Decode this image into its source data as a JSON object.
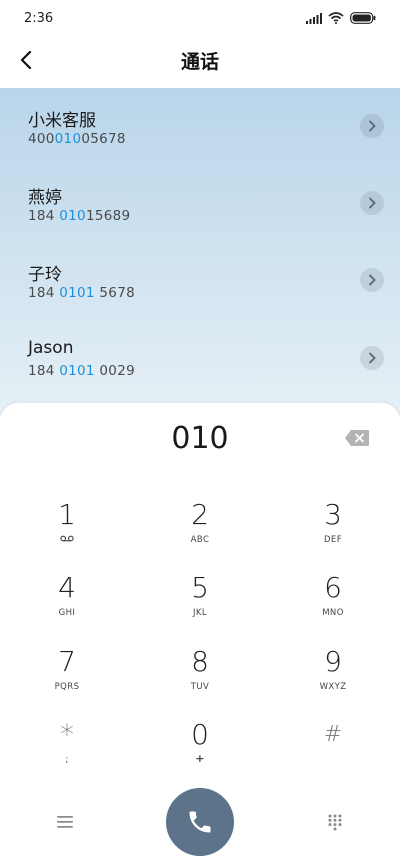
{
  "status": {
    "time": "2:36"
  },
  "header": {
    "title": "通话"
  },
  "results": [
    {
      "name": "小米客服",
      "number_pre": "400",
      "number_match": "010",
      "number_post": "05678"
    },
    {
      "name": "燕婷",
      "number_pre": "184 ",
      "number_match": "010",
      "number_post": "15689"
    },
    {
      "name": "子玲",
      "number_pre": "184 ",
      "number_match": "0101",
      "number_post": " 5678"
    },
    {
      "name": "Jason",
      "number_pre": "184 ",
      "number_match": "0101",
      "number_post": " 0029"
    }
  ],
  "dialpad": {
    "number": "010",
    "keys": [
      {
        "digit": "1",
        "letters": ""
      },
      {
        "digit": "2",
        "letters": "ABC"
      },
      {
        "digit": "3",
        "letters": "DEF"
      },
      {
        "digit": "4",
        "letters": "GHI"
      },
      {
        "digit": "5",
        "letters": "JKL"
      },
      {
        "digit": "6",
        "letters": "MNO"
      },
      {
        "digit": "7",
        "letters": "PQRS"
      },
      {
        "digit": "8",
        "letters": "TUV"
      },
      {
        "digit": "9",
        "letters": "WXYZ"
      },
      {
        "digit": "*",
        "letters": ";"
      },
      {
        "digit": "0",
        "letters": "+"
      },
      {
        "digit": "#",
        "letters": ""
      }
    ]
  },
  "colors": {
    "accent": "#1a90e0",
    "call_button": "#5c7389"
  },
  "icons": {
    "back": "back-arrow-icon",
    "signal": "signal-icon",
    "wifi": "wifi-icon",
    "battery": "battery-icon",
    "chevron": "chevron-right-icon",
    "backspace": "backspace-icon",
    "voicemail": "voicemail-icon",
    "menu": "menu-icon",
    "call": "phone-icon",
    "keypad": "keypad-icon"
  }
}
